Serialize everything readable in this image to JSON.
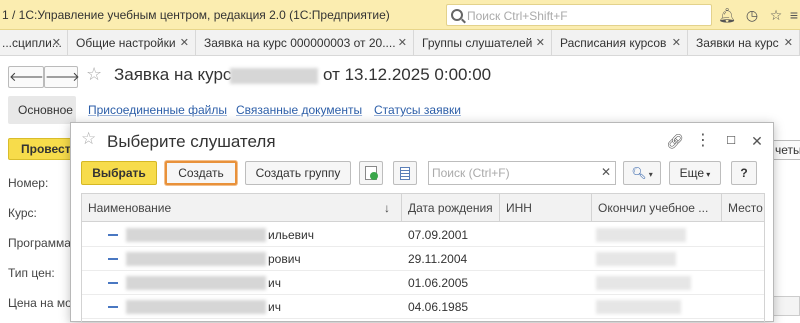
{
  "titlebar": {
    "title": "1 / 1С:Управление учебным центром, редакция 2.0  (1С:Предприятие)",
    "search_placeholder": "Поиск Ctrl+Shift+F",
    "icons": [
      "bell-icon",
      "history-icon",
      "star-icon",
      "menu-icon"
    ]
  },
  "tabs": [
    {
      "label": "...сципли...",
      "closable": true
    },
    {
      "label": "Общие настройки",
      "closable": true
    },
    {
      "label": "Заявка на курс 000000003 от 20....",
      "closable": true
    },
    {
      "label": "Группы слушателей",
      "closable": true
    },
    {
      "label": "Расписания курсов",
      "closable": true
    },
    {
      "label": "Заявки на курс",
      "closable": true
    }
  ],
  "form": {
    "title_prefix": "Заявка на курс",
    "title_suffix": "от 13.12.2025 0:00:00",
    "subtabs": {
      "main": "Основное",
      "files": "Присоединенные файлы",
      "docs": "Связанные документы",
      "statuses": "Статусы заявки"
    },
    "post_button": "Провест",
    "right_button_fragment": "четы",
    "labels": {
      "number": "Номер:",
      "course": "Курс:",
      "program": "Программа",
      "price_type": "Тип цен:",
      "price": "Цена на мо"
    }
  },
  "dialog": {
    "title": "Выберите слушателя",
    "buttons": {
      "select": "Выбрать",
      "create": "Создать",
      "create_group": "Создать группу",
      "more": "Еще",
      "help": "?"
    },
    "search_placeholder": "Поиск (Ctrl+F)",
    "columns": [
      "Наименование",
      "Дата рождения",
      "ИНН",
      "Окончил учебное ...",
      "Место"
    ],
    "sort_indicator": "↓",
    "rows": [
      {
        "name_tail": "ильевич",
        "birth_date": "07.09.2001"
      },
      {
        "name_tail": "рович",
        "birth_date": "29.11.2004"
      },
      {
        "name_tail": "ич",
        "birth_date": "01.06.2005"
      },
      {
        "name_tail": "ич",
        "birth_date": "04.06.1985"
      }
    ]
  }
}
